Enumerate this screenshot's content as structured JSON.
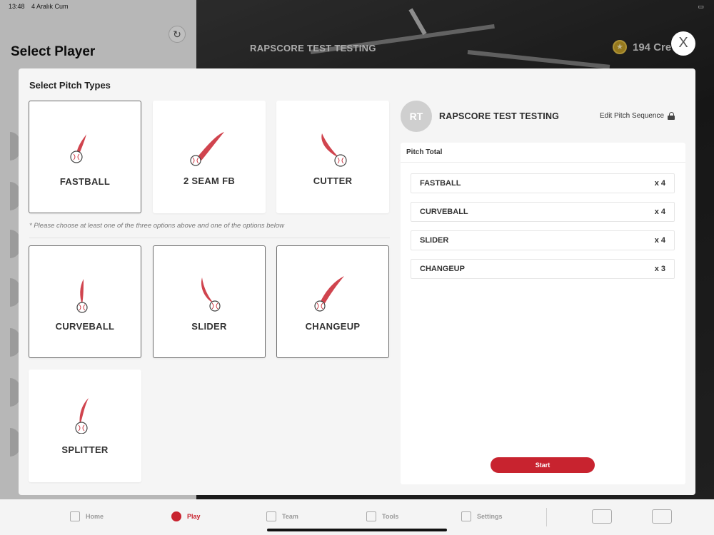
{
  "status": {
    "time": "13:48",
    "date": "4 Aralık Cum"
  },
  "background": {
    "title": "Select Player",
    "player_name": "RAPSCORE TEST TESTING",
    "credits": "194 Cre"
  },
  "modal": {
    "title": "Select Pitch Types",
    "hint": "* Please choose at least one of the three options above and one of the options below",
    "pitches_top": [
      {
        "label": "FASTBALL",
        "selected": true
      },
      {
        "label": "2 SEAM FB",
        "selected": false
      },
      {
        "label": "CUTTER",
        "selected": false
      }
    ],
    "pitches_bottom": [
      {
        "label": "CURVEBALL",
        "selected": true
      },
      {
        "label": "SLIDER",
        "selected": true
      },
      {
        "label": "CHANGEUP",
        "selected": true
      },
      {
        "label": "SPLITTER",
        "selected": false
      }
    ],
    "player": {
      "initials": "RT",
      "name": "RAPSCORE TEST TESTING"
    },
    "edit_sequence_label": "Edit Pitch Sequence",
    "pitch_total": {
      "title": "Pitch Total",
      "rows": [
        {
          "name": "FASTBALL",
          "count": "x 4"
        },
        {
          "name": "CURVEBALL",
          "count": "x 4"
        },
        {
          "name": "SLIDER",
          "count": "x 4"
        },
        {
          "name": "CHANGEUP",
          "count": "x 3"
        }
      ]
    },
    "start_label": "Start",
    "close_label": "X"
  },
  "tabbar": {
    "items": [
      {
        "label": "Home",
        "active": false
      },
      {
        "label": "Play",
        "active": true
      },
      {
        "label": "Team",
        "active": false
      },
      {
        "label": "Tools",
        "active": false
      },
      {
        "label": "Settings",
        "active": false
      }
    ]
  },
  "colors": {
    "accent": "#c8232f",
    "modal_bg": "#f5f5f5"
  }
}
